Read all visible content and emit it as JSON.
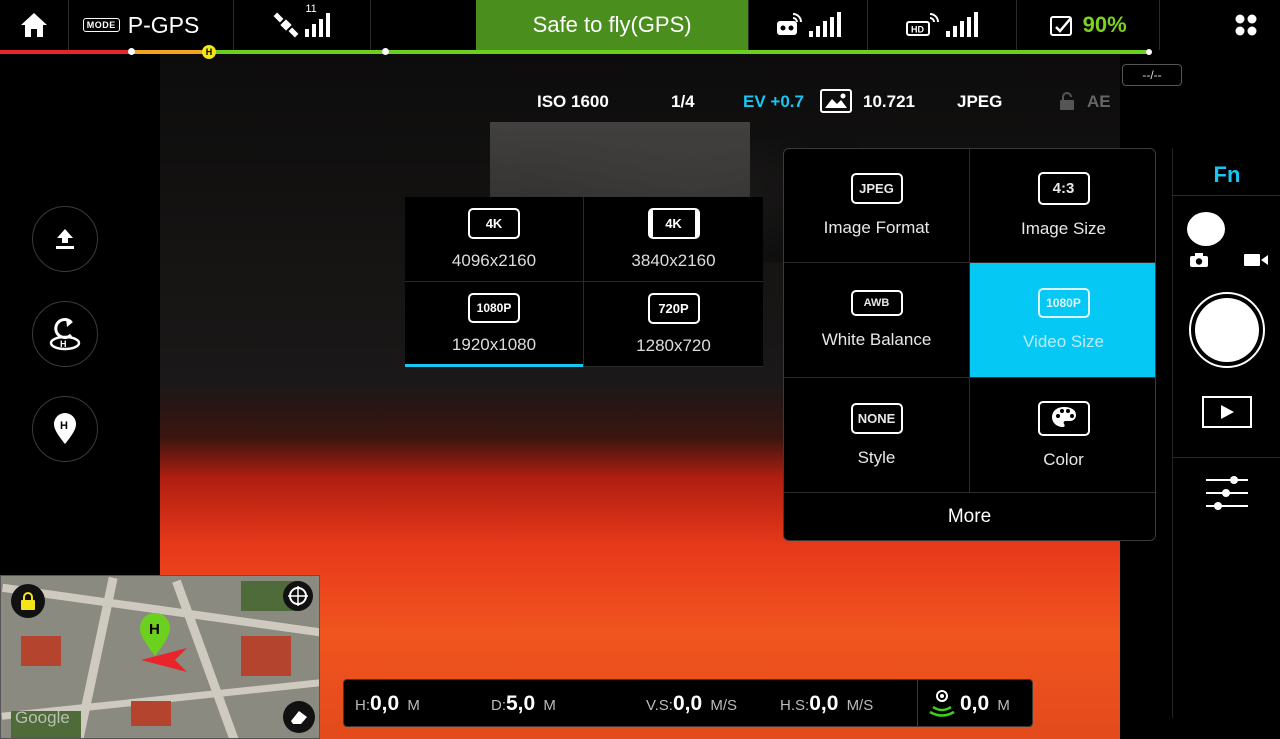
{
  "topbar": {
    "mode_badge": "MODE",
    "mode_value": "P-GPS",
    "satellite_count": "11",
    "status_text": "Safe to fly(GPS)",
    "battery_percent": "90%",
    "status_color": "#4a8f1e",
    "battery_color": "#7dd120"
  },
  "battery_line": {
    "home_marker": "H",
    "flight_time": "--/--"
  },
  "camera_params": {
    "iso": "ISO 1600",
    "aperture": "1/4",
    "ev": "EV +0.7",
    "capacity": "10.721",
    "format": "JPEG",
    "ae": "AE",
    "ev_color": "#19c6f2"
  },
  "resolution_options": [
    {
      "badge": "4K",
      "label": "4096x2160",
      "selected": false
    },
    {
      "badge": "4K",
      "label": "3840x2160",
      "selected": false
    },
    {
      "badge": "1080P",
      "label": "1920x1080",
      "selected": true
    },
    {
      "badge": "720P",
      "label": "1280x720",
      "selected": false
    }
  ],
  "settings_panel": {
    "items": [
      {
        "badge": "JPEG",
        "label": "Image Format"
      },
      {
        "badge": "4:3",
        "label": "Image Size"
      },
      {
        "badge": "AWB",
        "label": "White Balance"
      },
      {
        "badge": "1080P",
        "label": "Video Size",
        "active": true
      },
      {
        "badge": "NONE",
        "label": "Style"
      },
      {
        "badge": "palette-icon",
        "label": "Color"
      }
    ],
    "more_label": "More",
    "active_color": "#05c8f5"
  },
  "right_column": {
    "fn_label": "Fn"
  },
  "telemetry": {
    "h_label": "H:",
    "h_value": "0,0",
    "h_unit": "M",
    "d_label": "D:",
    "d_value": "5,0",
    "d_unit": "M",
    "vs_label": "V.S:",
    "vs_value": "0,0",
    "vs_unit": "M/S",
    "hs_label": "H.S:",
    "hs_value": "0,0",
    "hs_unit": "M/S",
    "vps_value": "0,0",
    "vps_unit": "M"
  },
  "map": {
    "home_marker": "H",
    "watermark": "Google"
  }
}
